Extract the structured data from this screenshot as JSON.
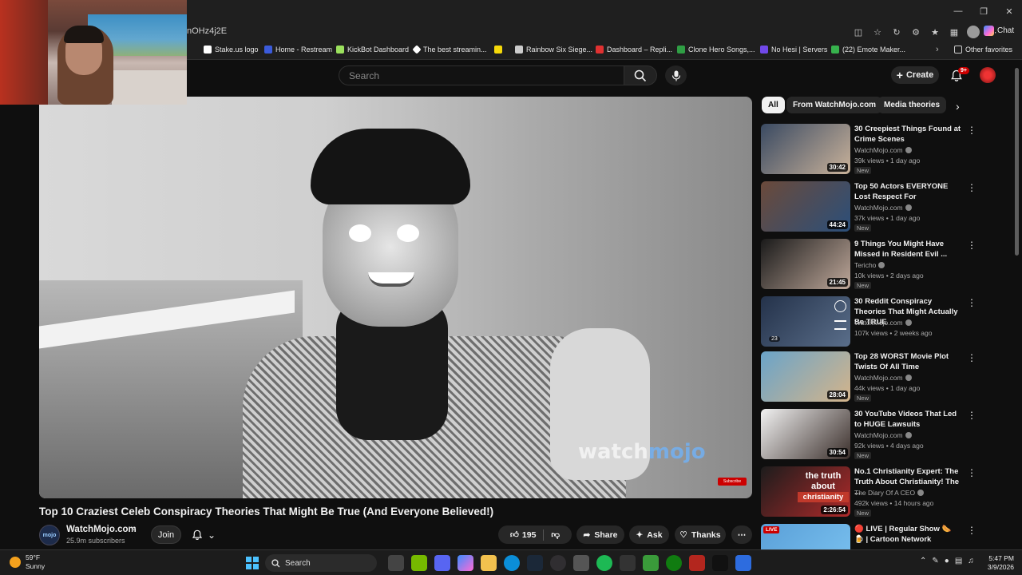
{
  "browser": {
    "url": "nOHz4j2E",
    "chat_label": "Chat",
    "window_controls": [
      "minimize",
      "restore",
      "close"
    ],
    "bookmarks": [
      {
        "label": "Stake.us logo",
        "color": "#ffffff"
      },
      {
        "label": "Home - Restream",
        "color": "#3b5bdb"
      },
      {
        "label": "KickBot Dashboard",
        "color": "#9be15d"
      },
      {
        "label": "The best streamin...",
        "color": "#ffffff"
      },
      {
        "label": "",
        "color": "#f5d90a"
      },
      {
        "label": "Rainbow Six Siege...",
        "color": "#cccccc"
      },
      {
        "label": "Dashboard – Repli...",
        "color": "#e03131"
      },
      {
        "label": "Clone Hero Songs,...",
        "color": "#2f9e44"
      },
      {
        "label": "No Hesi | Servers",
        "color": "#7048e8"
      },
      {
        "label": "(22) Emote Maker...",
        "color": "#37b24d"
      }
    ],
    "other_favorites": "Other favorites"
  },
  "youtube": {
    "search_placeholder": "Search",
    "create_label": "Create",
    "notification_count": "9+"
  },
  "video": {
    "title": "Top 10 Craziest Celeb Conspiracy Theories That Might Be True (And Everyone Believed!)",
    "watermark_a": "watch",
    "watermark_b": "mojo",
    "subscribe_badge": "Subscribe",
    "channel_avatar": "mojo",
    "channel_name": "WatchMojo.com",
    "subscribers": "25.9m subscribers",
    "join_label": "Join",
    "likes": "195",
    "share_label": "Share",
    "ask_label": "Ask",
    "thanks_label": "Thanks"
  },
  "chips": [
    "All",
    "From WatchMojo.com",
    "Media theories"
  ],
  "recommendations": [
    {
      "title": "30 Creepiest Things Found at Crime Scenes",
      "channel": "WatchMojo.com",
      "verified": true,
      "views": "39k views",
      "age": "1 day ago",
      "badge": "New",
      "duration": "30:42",
      "thumb": [
        "#3a4a62",
        "#c9b29a"
      ]
    },
    {
      "title": "Top 50 Actors EVERYONE Lost Respect For",
      "channel": "WatchMojo.com",
      "verified": true,
      "views": "37k views",
      "age": "1 day ago",
      "badge": "New",
      "duration": "44:24",
      "thumb": [
        "#6b4a3a",
        "#2b4f7a"
      ]
    },
    {
      "title": "9 Things You Might Have Missed in Resident Evil ...",
      "channel": "Tericho",
      "verified": true,
      "views": "10k views",
      "age": "2 days ago",
      "badge": "New",
      "duration": "21:45",
      "thumb": [
        "#1a1a1a",
        "#bfa89a"
      ]
    },
    {
      "title": "30 Reddit Conspiracy Theories That Might Actually Be TRUE",
      "channel": "WatchMojo.com",
      "verified": true,
      "views": "107k views",
      "age": "2 weeks ago",
      "badge": "",
      "duration": "",
      "count": "23",
      "thumb": [
        "#24324a",
        "#5a6e8a"
      ]
    },
    {
      "title": "Top 28 WORST Movie Plot Twists Of All Time",
      "channel": "WatchMojo.com",
      "verified": true,
      "views": "44k views",
      "age": "1 day ago",
      "badge": "New",
      "duration": "28:04",
      "thumb": [
        "#6aa4c9",
        "#d4b48a"
      ]
    },
    {
      "title": "30 YouTube Videos That Led to HUGE Lawsuits",
      "channel": "WatchMojo.com",
      "verified": true,
      "views": "92k views",
      "age": "4 days ago",
      "badge": "New",
      "duration": "30:54",
      "thumb": [
        "#f2f2f2",
        "#3a2e2a"
      ]
    },
    {
      "title": "No.1 Christianity Expert: The Truth About Christianity! The ...",
      "channel": "The Diary Of A CEO",
      "verified": true,
      "views": "492k views",
      "age": "14 hours ago",
      "badge": "New",
      "duration": "2:26:54",
      "overlay_a": "the truth",
      "overlay_b": "about",
      "overlay_c": "christianity",
      "thumb": [
        "#1c1c1c",
        "#b02a2a"
      ]
    },
    {
      "title": "🔴 LIVE | Regular Show 🌭 🍺 | Cartoon Network",
      "channel": "",
      "verified": false,
      "views": "",
      "age": "",
      "badge": "",
      "duration": "",
      "live": "LIVE",
      "thumb": [
        "#5aa0d8",
        "#7bc2f0"
      ]
    }
  ],
  "taskbar": {
    "weather_temp": "59°F",
    "weather_desc": "Sunny",
    "search_label": "Search",
    "time": "5:47 PM",
    "date": "3/9/2026"
  }
}
